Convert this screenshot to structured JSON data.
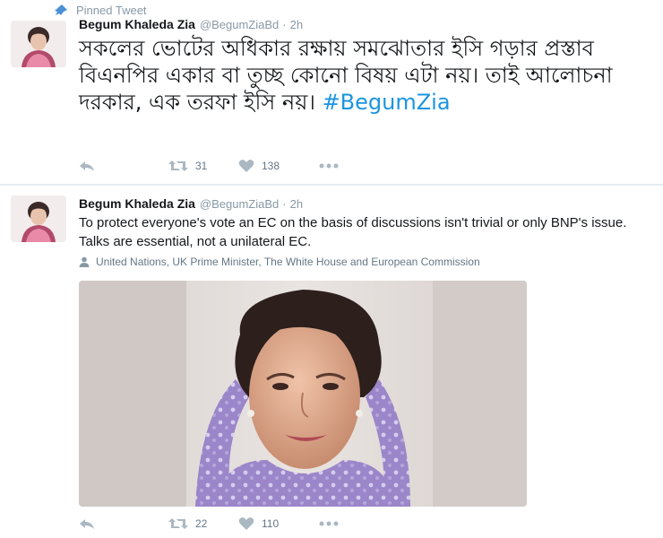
{
  "pinned": {
    "label": "Pinned Tweet"
  },
  "tweets": [
    {
      "name": "Begum Khaleda Zia",
      "handle": "@BegumZiaBd",
      "dot": "·",
      "time": "2h",
      "text": "সকলের ভোটের অধিকার রক্ষায় সমঝোতার ইসি গড়ার প্রস্তাব বিএনপির একার বা তুচ্ছ কোনো বিষয় এটা নয়। তাই আলোচনা দরকার, এক তরফা ইসি নয়।",
      "hashtag": "#BegumZia",
      "retweets": "31",
      "likes": "138"
    },
    {
      "name": "Begum Khaleda Zia",
      "handle": "@BegumZiaBd",
      "dot": "·",
      "time": "2h",
      "text": "To protect everyone's vote an EC on the basis of discussions isn't trivial or only BNP's issue. Talks are essential, not a unilateral EC.",
      "tagged": "United Nations, UK Prime Minister, The White House and European Commission",
      "retweets": "22",
      "likes": "110"
    }
  ],
  "icons": {
    "pin": "pin-icon",
    "reply": "reply-icon",
    "retweet": "retweet-icon",
    "like": "heart-icon",
    "more": "more-icon",
    "tagged": "person-icon"
  },
  "colors": {
    "link": "#1b95e0",
    "secondary": "#8899a6",
    "action": "#aab8c2",
    "text": "#14171a"
  }
}
